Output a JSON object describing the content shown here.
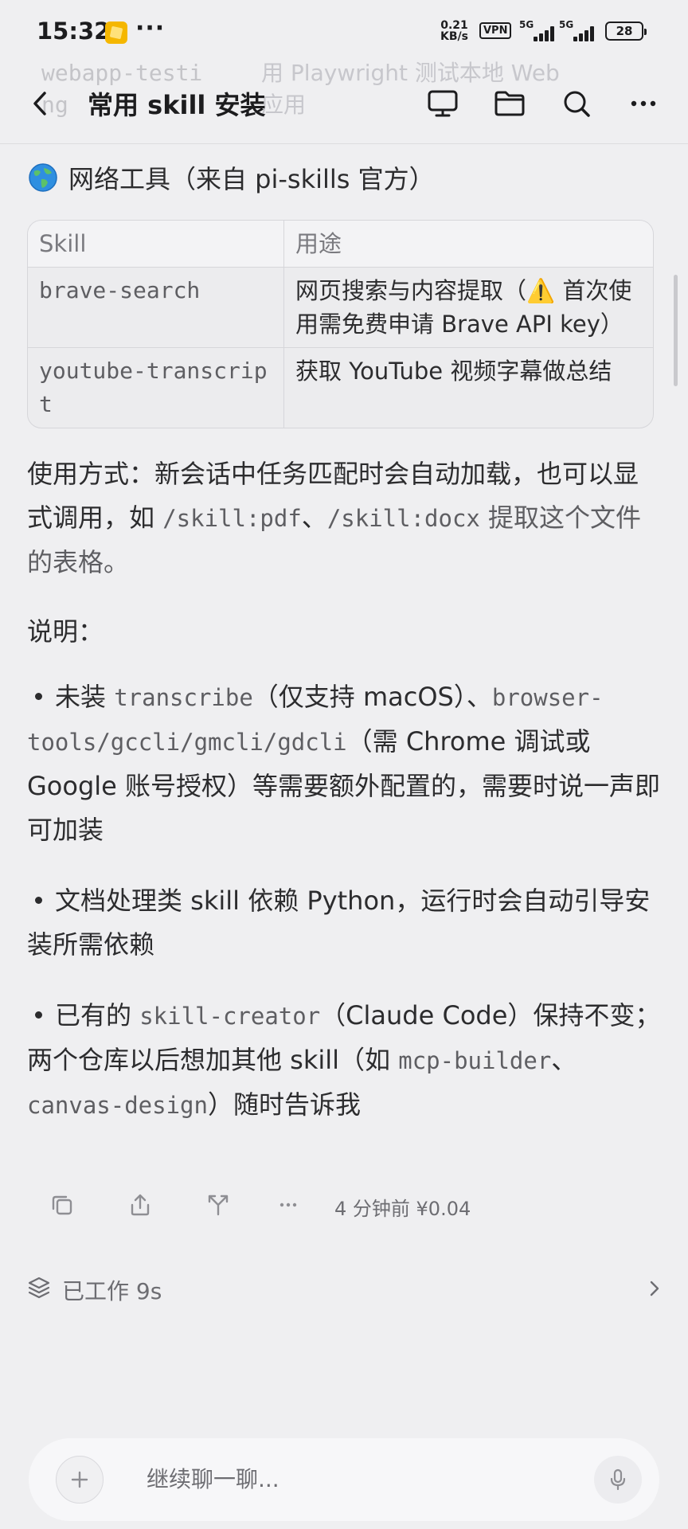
{
  "status_bar": {
    "time": "15:32",
    "more": "···",
    "net_speed_value": "0.21",
    "net_speed_unit": "KB/s",
    "vpn": "VPN",
    "signal1": "5G",
    "signal2": "5G",
    "battery": "28"
  },
  "ghost": {
    "left": "webapp-testi",
    "left2": "ng",
    "right": "用 Playwright 测试本地 Web",
    "right2": "应用"
  },
  "header": {
    "title": "常用 skill 安装"
  },
  "section": {
    "heading": "网络工具（来自 pi-skills 官方）"
  },
  "table": {
    "headers": [
      "Skill",
      "用途"
    ],
    "rows": [
      {
        "skill": "brave-search",
        "use": "网页搜索与内容提取（⚠️ 首次使用需免费申请 Brave API key）"
      },
      {
        "skill": "youtube-transcript",
        "use": "获取 YouTube 视频字幕做总结"
      }
    ]
  },
  "usage": {
    "prefix": "使用方式：新会话中任务匹配时会自动加载，也可以显式调用，如 ",
    "code1": "/skill:pdf",
    "sep": "、",
    "code2": "/skill:docx",
    "suffix": " 提取这个文件的表格。"
  },
  "notes": {
    "heading": "说明：",
    "b1_pre": "未装 ",
    "b1_code1": "transcribe",
    "b1_mid": "（仅支持 macOS）、",
    "b1_code2": "browser-tools",
    "b1_slash1": "/",
    "b1_code3": "gccli",
    "b1_slash2": "/",
    "b1_code4": "gmcli",
    "b1_slash3": "/",
    "b1_code5": "gdcli",
    "b1_post": "（需 Chrome 调试或 Google 账号授权）等需要额外配置的，需要时说一声即可加装",
    "b2": "文档处理类 skill 依赖 Python，运行时会自动引导安装所需依赖",
    "b3_pre": "已有的 ",
    "b3_code1": "skill-creator",
    "b3_mid": "（Claude Code）保持不变；两个仓库以后想加其他 skill（如 ",
    "b3_code2": "mcp-builder",
    "b3_sep": "、",
    "b3_code3": "canvas-design",
    "b3_post": "）随时告诉我"
  },
  "actions": {
    "meta": "4 分钟前 ¥0.04"
  },
  "worked": {
    "label": "已工作 9s"
  },
  "input": {
    "placeholder": "继续聊一聊..."
  },
  "icons": [
    "back-arrow-icon",
    "monitor-icon",
    "folder-icon",
    "search-icon",
    "more-icon",
    "globe-icon",
    "copy-icon",
    "share-icon",
    "fork-icon",
    "more-dots-icon",
    "layers-icon",
    "chevron-right-icon",
    "plus-icon",
    "mic-icon"
  ]
}
